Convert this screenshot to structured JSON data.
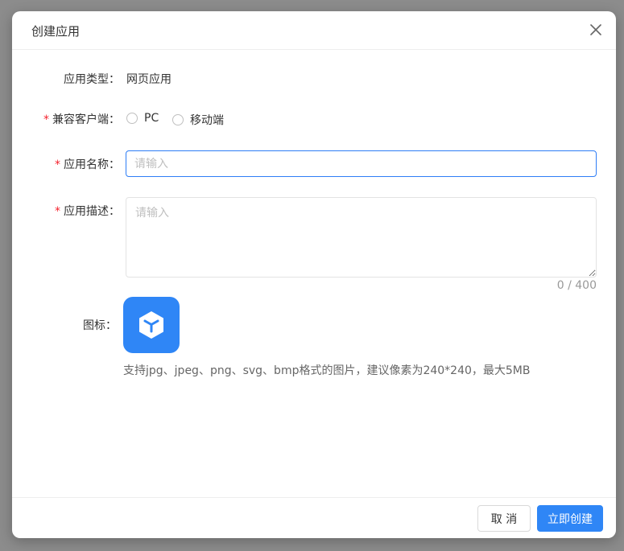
{
  "dialog": {
    "title": "创建应用"
  },
  "form": {
    "app_type": {
      "label": "应用类型：",
      "value": "网页应用"
    },
    "client": {
      "required_mark": "*",
      "label": "兼容客户端：",
      "options": [
        {
          "label": "PC",
          "selected": false
        },
        {
          "label": "移动端",
          "selected": false
        }
      ]
    },
    "name": {
      "required_mark": "*",
      "label": "应用名称：",
      "value": "",
      "placeholder": "请输入"
    },
    "description": {
      "required_mark": "*",
      "label": "应用描述：",
      "value": "",
      "placeholder": "请输入",
      "counter": "0 / 400"
    },
    "icon": {
      "label": "图标：",
      "icon_name": "cube-icon",
      "hint": "支持jpg、jpeg、png、svg、bmp格式的图片，建议像素为240*240，最大5MB"
    }
  },
  "footer": {
    "cancel_label": "取 消",
    "submit_label": "立即创建"
  },
  "colors": {
    "primary": "#2f86f6",
    "required": "#f5222d",
    "overlay": "#8c8c8c"
  }
}
